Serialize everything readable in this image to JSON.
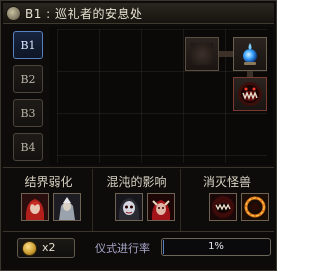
{
  "window": {
    "title": "B1 : 巡礼者的安息处",
    "icon": "medallion-icon"
  },
  "floors": {
    "active": "B1",
    "tabs": [
      {
        "label": "B1"
      },
      {
        "label": "B2"
      },
      {
        "label": "B3"
      },
      {
        "label": "B4"
      }
    ]
  },
  "map": {
    "rooms": [
      {
        "name": "start-room",
        "icon": "empty-room"
      },
      {
        "name": "blue-room",
        "icon": "blue-orb-icon"
      },
      {
        "name": "boss-room",
        "icon": "boss-face-icon"
      }
    ]
  },
  "rituals": [
    {
      "title": "结界弱化",
      "icons": [
        "red-haired-woman-icon",
        "armored-figure-icon"
      ]
    },
    {
      "title": "混沌的影响",
      "icons": [
        "pale-ghost-icon",
        "red-demon-icon"
      ]
    },
    {
      "title": "消灭怪兽",
      "icons": [
        "fanged-maw-icon",
        "fire-ring-icon"
      ]
    }
  ],
  "bottom": {
    "coin_count": "x2",
    "coin_icon": "gold-coin-icon",
    "progress_label": "仪式进行率",
    "progress_text": "1%",
    "progress_value": 0.01
  },
  "colors": {
    "accent_blue": "#5a7fbf",
    "panel_bg": "#0d0c0b",
    "text": "#d8d2c2"
  }
}
